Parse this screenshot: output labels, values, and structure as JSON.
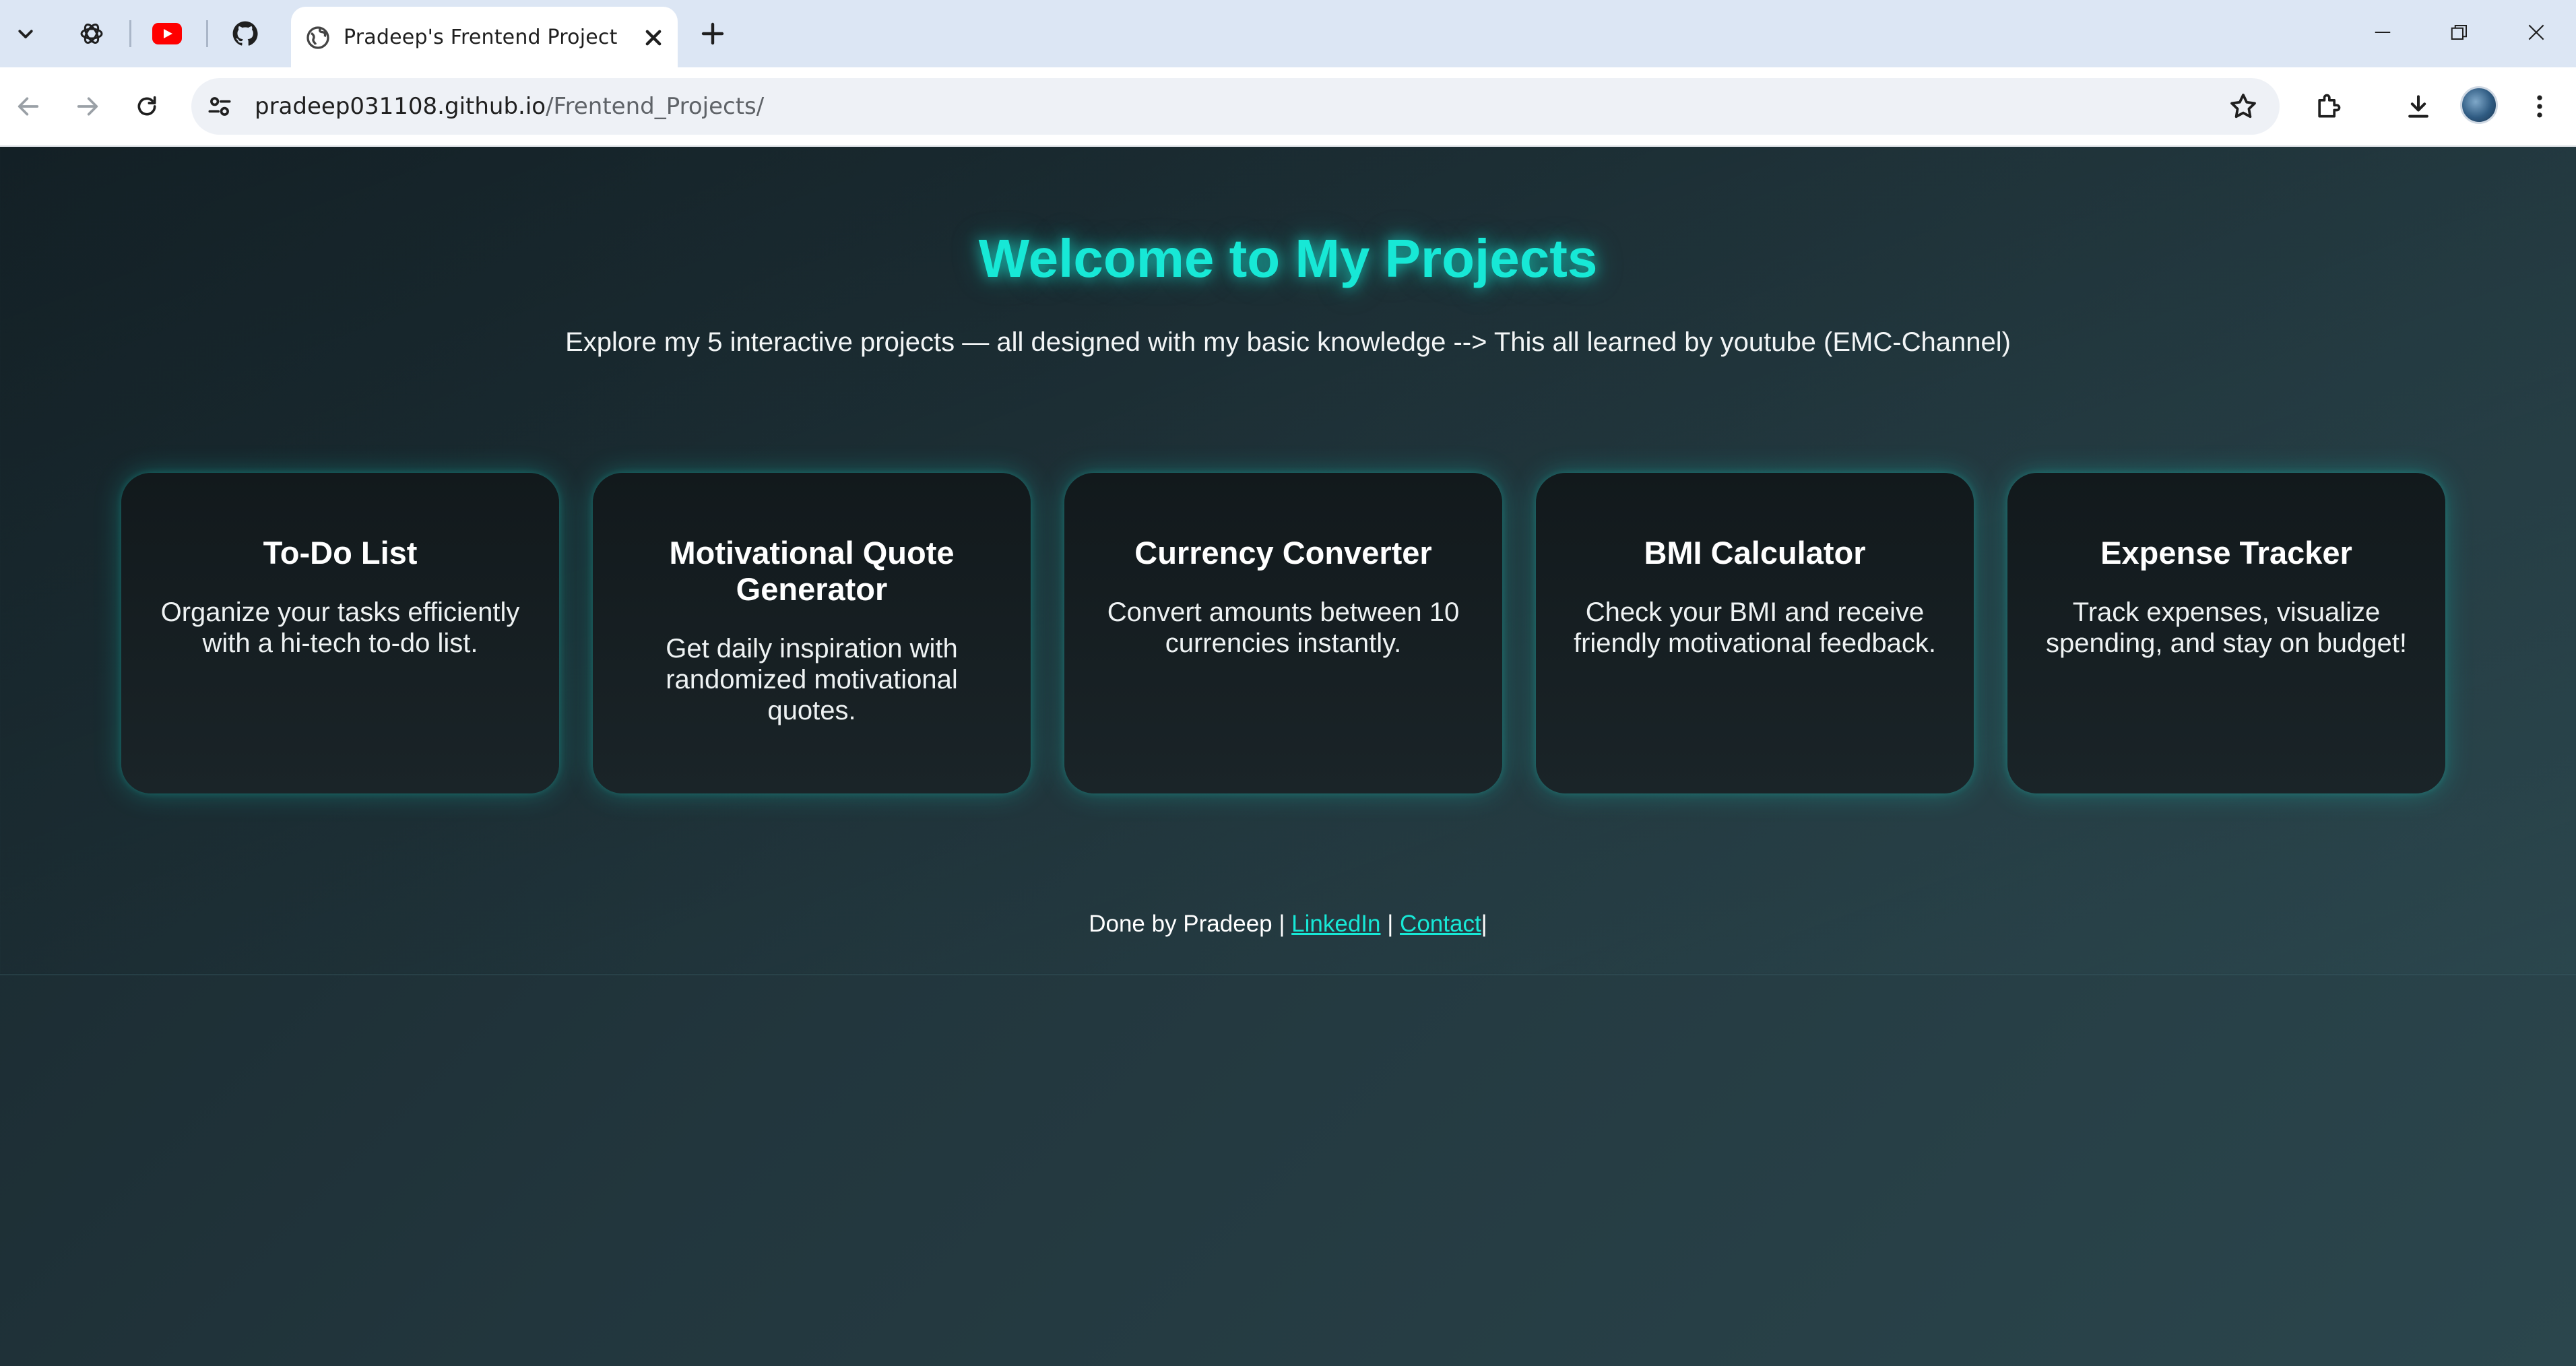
{
  "browser": {
    "tab": {
      "title": "Pradeep's Frentend Project"
    },
    "pinned_tabs": [
      "chatgpt-icon",
      "youtube-icon",
      "github-icon"
    ],
    "url": {
      "host": "pradeep031108.github.io",
      "path": "/Frentend_Projects/"
    }
  },
  "page": {
    "headline": "Welcome to My Projects",
    "subhead": "Explore my 5 interactive projects — all designed with my basic knowledge --> This all learned by youtube (EMC-Channel)",
    "cards": [
      {
        "title": "To-Do List",
        "desc": "Organize your tasks efficiently with a hi-tech to-do list."
      },
      {
        "title": "Motivational Quote Generator",
        "desc": "Get daily inspiration with randomized motivational quotes."
      },
      {
        "title": "Currency Converter",
        "desc": "Convert amounts between 10 currencies instantly."
      },
      {
        "title": "BMI Calculator",
        "desc": "Check your BMI and receive friendly motivational feedback."
      },
      {
        "title": "Expense Tracker",
        "desc": "Track expenses, visualize spending, and stay on budget!"
      }
    ],
    "footer": {
      "prefix": "Done by Pradeep | ",
      "linkedin": "LinkedIn",
      "sep": " | ",
      "contact": "Contact",
      "suffix": "|"
    }
  },
  "colors": {
    "accent": "#17e8d6",
    "background": "#1f3238",
    "card": "#151d21"
  }
}
